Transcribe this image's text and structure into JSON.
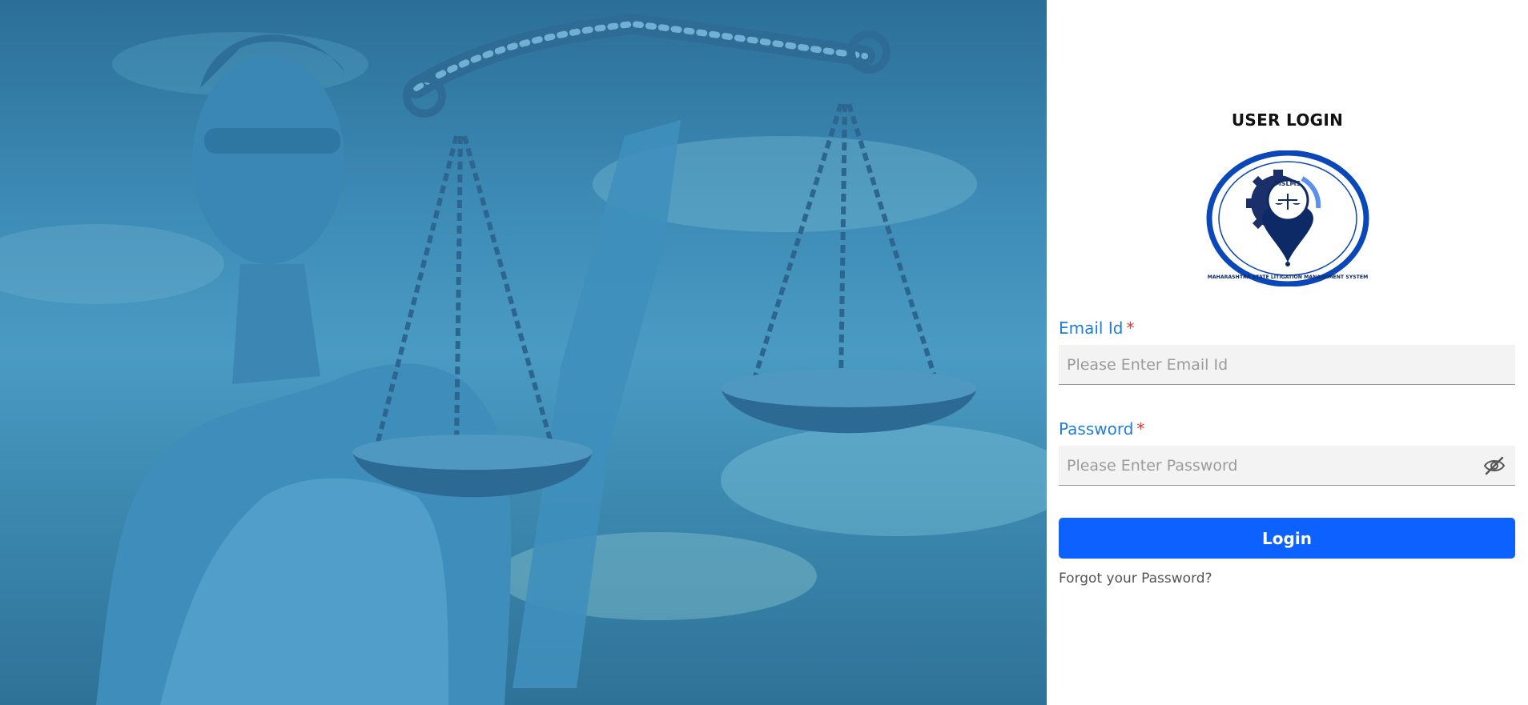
{
  "hero": {
    "image": "lady-justice-statue-with-scales"
  },
  "login": {
    "title": "USER LOGIN",
    "logo": {
      "top_text": "MSLMS",
      "ring_text": "MAHARASHTRA STATE LITIGATION MANAGEMENT SYSTEM"
    },
    "email": {
      "label": "Email Id",
      "required_mark": "*",
      "placeholder": "Please Enter Email Id",
      "value": ""
    },
    "password": {
      "label": "Password",
      "required_mark": "*",
      "placeholder": "Please Enter Password",
      "value": "",
      "toggle_icon": "eye-slash-icon"
    },
    "submit_label": "Login",
    "forgot_label": "Forgot your Password?"
  },
  "colors": {
    "label_blue": "#1f7fd6",
    "required_red": "#e53935",
    "button_blue": "#0d62ff",
    "logo_blue": "#0a47b8",
    "hero_tint": "#3c8ab5"
  }
}
